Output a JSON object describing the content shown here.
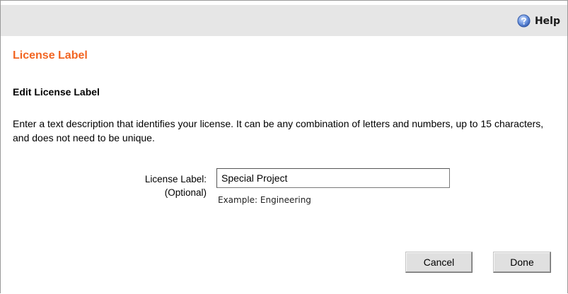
{
  "toolbar": {
    "help_label": "Help",
    "help_icon": "help-icon"
  },
  "page": {
    "title": "License Label",
    "subtitle": "Edit License Label",
    "description": "Enter a text description that identifies your license. It can be any combination of letters and numbers, up to 15 characters, and does not need to be unique."
  },
  "form": {
    "label_line1": "License Label:",
    "label_line2": "(Optional)",
    "input_value": "Special Project",
    "example_text": "Example: Engineering"
  },
  "buttons": {
    "cancel_label": "Cancel",
    "done_label": "Done"
  },
  "colors": {
    "title": "#f26522",
    "topbar": "#e6e6e6",
    "help_icon": "#4a78c8"
  }
}
